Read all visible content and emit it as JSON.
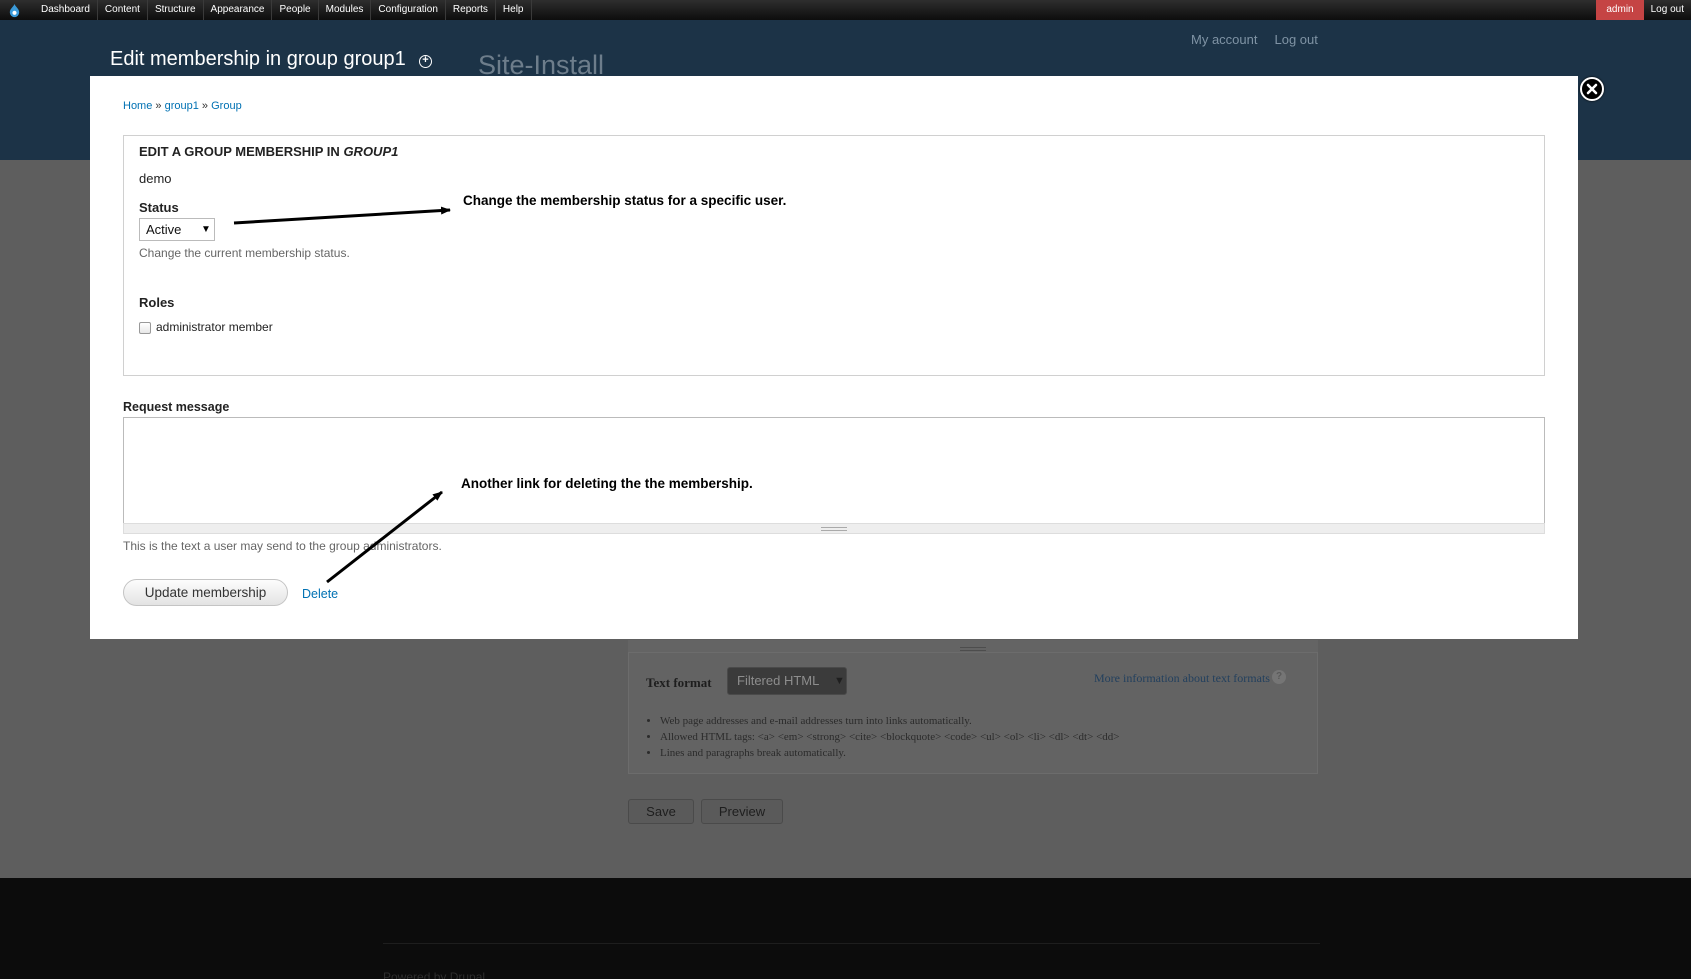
{
  "toolbar": {
    "menu": [
      "Dashboard",
      "Content",
      "Structure",
      "Appearance",
      "People",
      "Modules",
      "Configuration",
      "Reports",
      "Help"
    ],
    "user_name": "admin",
    "logout": "Log out"
  },
  "header": {
    "overlay_title": "Edit membership in group group1",
    "shortcut_icon": "add-shortcut-icon",
    "site_name": "Site-Install",
    "secondary_menu": [
      "My account",
      "Log out"
    ]
  },
  "breadcrumb": {
    "items": [
      "Home",
      "group1",
      "Group"
    ],
    "separator": "»"
  },
  "form": {
    "legend_prefix": "Edit a group membership in",
    "legend_group": "group1",
    "member_name": "demo",
    "status_label": "Status",
    "status_value": "Active",
    "status_description": "Change the current membership status.",
    "roles_label": "Roles",
    "role_option": "administrator member",
    "role_checked": false,
    "request_label": "Request message",
    "request_value": "",
    "request_description": "This is the text a user may send to the group administrators.",
    "submit_label": "Update membership",
    "delete_label": "Delete"
  },
  "annotations": {
    "status_note": "Change the membership status for a specific user.",
    "delete_note": "Another link for deleting the the membership."
  },
  "background": {
    "text_format_label": "Text format",
    "text_format_value": "Filtered HTML",
    "text_format_help": "More information about text formats",
    "tips": [
      "Web page addresses and e-mail addresses turn into links automatically.",
      "Allowed HTML tags: <a> <em> <strong> <cite> <blockquote> <code> <ul> <ol> <li> <dl> <dt> <dd>",
      "Lines and paragraphs break automatically."
    ],
    "save_label": "Save",
    "preview_label": "Preview",
    "footer_text": "Powered by Drupal"
  },
  "colors": {
    "toolbar_active": "#c54444",
    "link": "#0071b3",
    "header_bg": "#1c3347"
  }
}
